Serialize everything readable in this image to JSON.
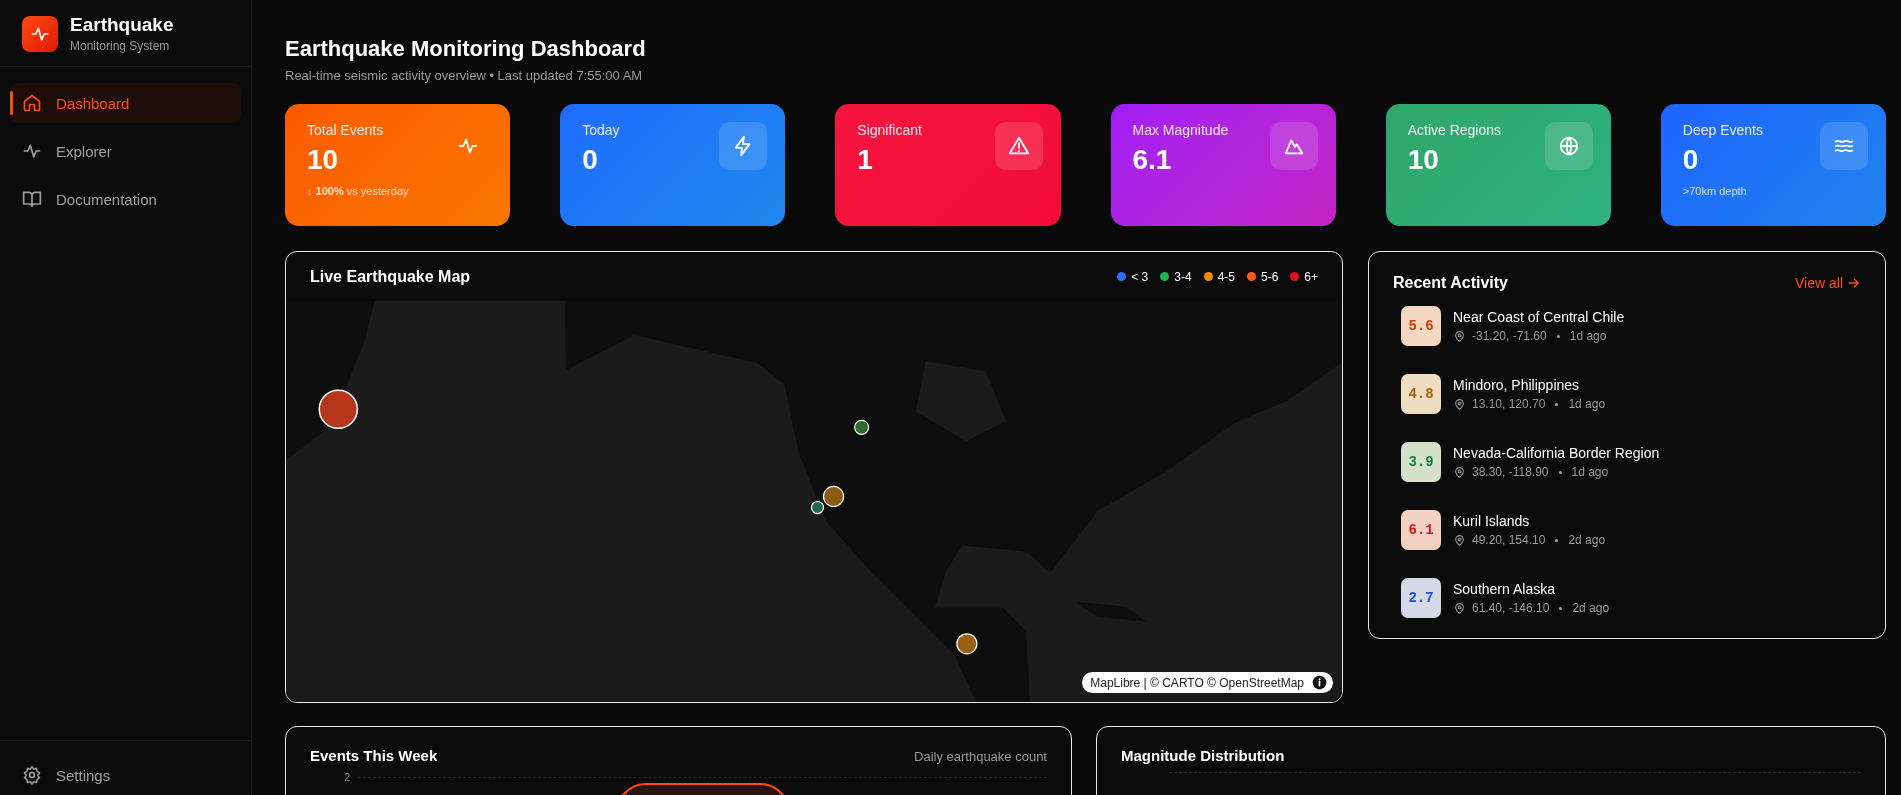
{
  "sidebar": {
    "app_name": "Earthquake",
    "app_subtitle": "Monitoring System",
    "items": [
      {
        "label": "Dashboard",
        "selected": true
      },
      {
        "label": "Explorer",
        "selected": false
      },
      {
        "label": "Documentation",
        "selected": false
      }
    ],
    "footer_item": {
      "label": "Settings",
      "selected": false
    }
  },
  "header": {
    "title": "Earthquake Monitoring Dashboard",
    "subtitle": "Real-time seismic activity overview • Last updated 7:55:00 AM"
  },
  "stat_cards": [
    {
      "label": "Total Events",
      "value": "10",
      "note": "**↓ 100%** vs yesterday",
      "color": "#f95a00"
    },
    {
      "label": "Today",
      "value": "0",
      "color": "#1f6cff"
    },
    {
      "label": "Significant",
      "value": "1",
      "color": "#f5153f"
    },
    {
      "label": "Max Magnitude",
      "value": "6.1",
      "color": "#a21cf5"
    },
    {
      "label": "Active Regions",
      "value": "10",
      "color": "#2ea66a"
    },
    {
      "label": "Deep Events",
      "value": "0",
      "note": ">70km depth",
      "color": "#2064ff"
    }
  ],
  "map": {
    "title": "Live Earthquake Map",
    "legend": [
      {
        "label": "< 3",
        "color": "#2f6bff"
      },
      {
        "label": "3-4",
        "color": "#22b14c"
      },
      {
        "label": "4-5",
        "color": "#f08a00"
      },
      {
        "label": "5-6",
        "color": "#ff5a14"
      },
      {
        "label": "6+",
        "color": "#e0101e"
      }
    ],
    "kind": "picture",
    "attribution": "MapLibre | © CARTO © OpenStreetMap"
  },
  "recent_activity": {
    "title": "Recent Activity",
    "link": "View all",
    "items": [
      {
        "magnitude": "5.6",
        "color": "#c2410c",
        "place": "Near Coast of Central Chile",
        "coords": "-31.20, -71.60",
        "time": "1d ago"
      },
      {
        "magnitude": "4.8",
        "color": "#a16207",
        "place": "Mindoro, Philippines",
        "coords": "13.10, 120.70",
        "time": "1d ago"
      },
      {
        "magnitude": "3.9",
        "color": "#15803d",
        "place": "Nevada-California Border Region",
        "coords": "38.30, -118.90",
        "time": "1d ago"
      },
      {
        "magnitude": "6.1",
        "color": "#c81e1e",
        "place": "Kuril Islands",
        "coords": "49.20, 154.10",
        "time": "2d ago"
      },
      {
        "magnitude": "2.7",
        "color": "#1d4ed8",
        "place": "Southern Alaska",
        "coords": "61.40, -146.10",
        "time": "2d ago"
      }
    ]
  },
  "events_chart": {
    "title": "Events This Week",
    "caption": "Daily earthquake count",
    "y_tick": "2"
  },
  "magnitude_chart": {
    "title": "Magnitude Distribution"
  }
}
